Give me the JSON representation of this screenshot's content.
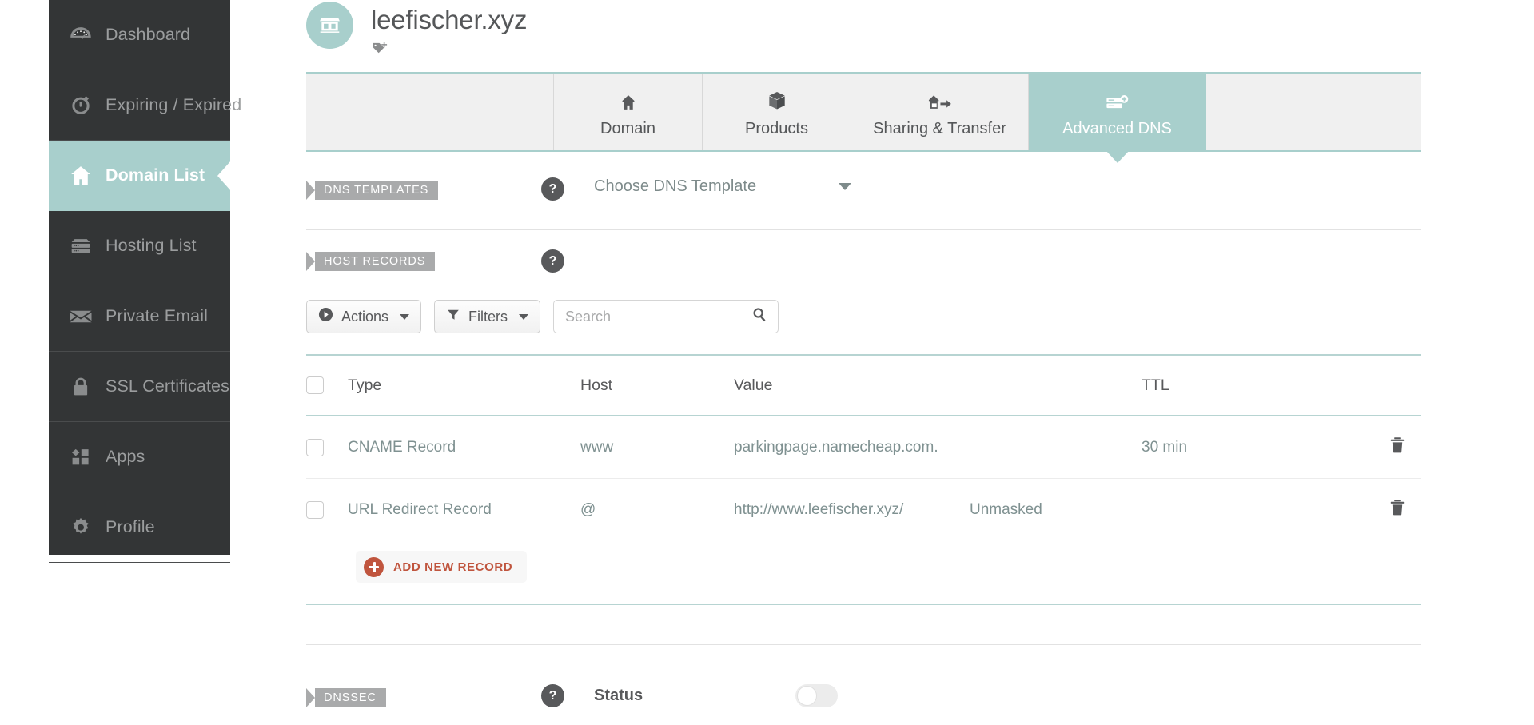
{
  "sidebar": {
    "items": [
      {
        "label": "Dashboard",
        "icon": "gauge-icon",
        "active": false
      },
      {
        "label": "Expiring / Expired",
        "icon": "stopwatch-icon",
        "active": false
      },
      {
        "label": "Domain List",
        "icon": "house-icon",
        "active": true
      },
      {
        "label": "Hosting List",
        "icon": "server-icon",
        "active": false
      },
      {
        "label": "Private Email",
        "icon": "envelope-icon",
        "active": false
      },
      {
        "label": "SSL Certificates",
        "icon": "lock-icon",
        "active": false
      },
      {
        "label": "Apps",
        "icon": "apps-icon",
        "active": false
      },
      {
        "label": "Profile",
        "icon": "gear-icon",
        "active": false
      }
    ]
  },
  "header": {
    "domain": "leefischer.xyz",
    "avatar_icon": "storefront-icon",
    "tag_icon": "tag-plus-icon"
  },
  "tabs": [
    {
      "label": "",
      "icon": "",
      "active": false
    },
    {
      "label": "Domain",
      "icon": "house-icon",
      "active": false
    },
    {
      "label": "Products",
      "icon": "box-icon",
      "active": false
    },
    {
      "label": "Sharing & Transfer",
      "icon": "transfer-icon",
      "active": false
    },
    {
      "label": "Advanced DNS",
      "icon": "dns-server-icon",
      "active": true
    }
  ],
  "dns_templates": {
    "ribbon": "DNS TEMPLATES",
    "help": "?",
    "select_value": "Choose DNS Template"
  },
  "host_records": {
    "ribbon": "HOST RECORDS",
    "help": "?",
    "toolbar": {
      "actions_label": "Actions",
      "filters_label": "Filters",
      "search_placeholder": "Search",
      "search_value": ""
    },
    "columns": [
      "Type",
      "Host",
      "Value",
      "",
      "TTL"
    ],
    "rows": [
      {
        "type": "CNAME Record",
        "host": "www",
        "value": "parkingpage.namecheap.com.",
        "extra": "",
        "ttl": "30 min"
      },
      {
        "type": "URL Redirect Record",
        "host": "@",
        "value": "http://www.leefischer.xyz/",
        "extra": "Unmasked",
        "ttl": ""
      }
    ],
    "add_record_label": "ADD NEW RECORD"
  },
  "dnssec": {
    "ribbon": "DNSSEC",
    "help": "?",
    "status_label": "Status",
    "status_on": false
  },
  "colors": {
    "teal": "#a8cfcc",
    "teal_border": "#b7d4d2",
    "sidebar_bg": "#333536",
    "ribbon_gray": "#a9aaab",
    "help_gray": "#58595b",
    "accent_red": "#c0553e",
    "text_gray": "#58595b",
    "row_text": "#7f9191"
  }
}
